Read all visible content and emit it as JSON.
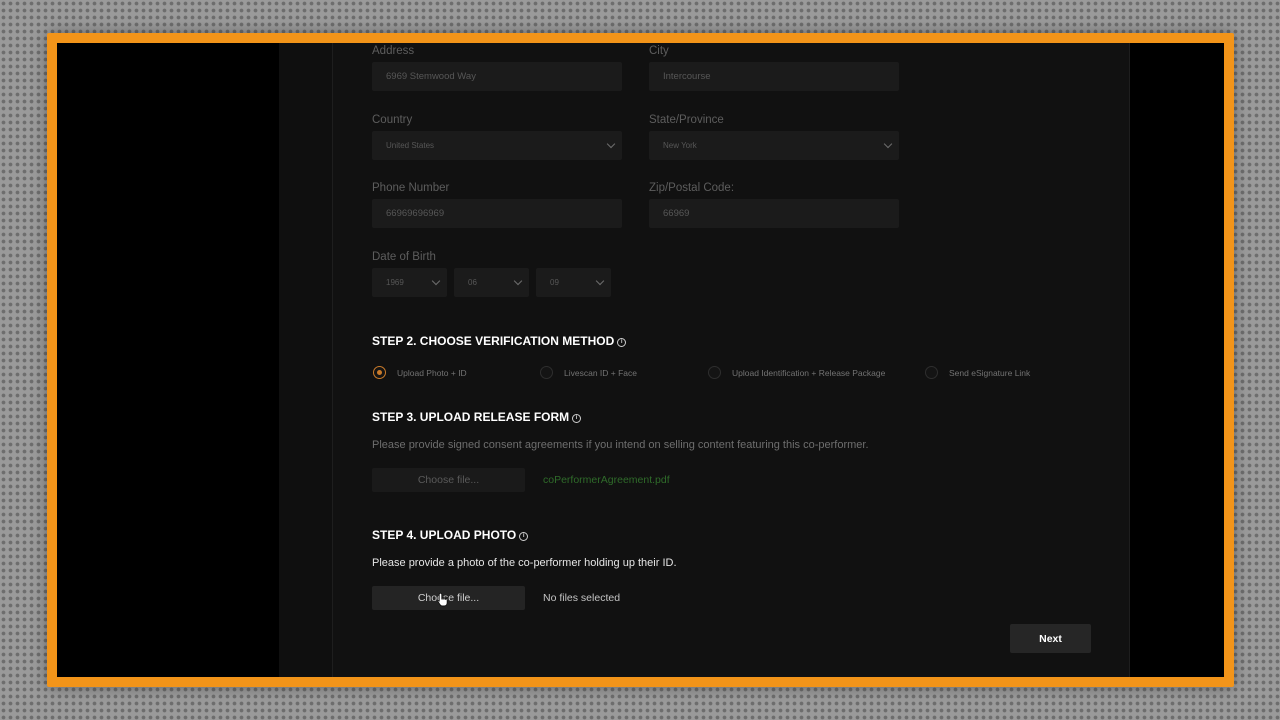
{
  "colors": {
    "frame": "#f29419",
    "accent": "#c97a2a",
    "file_name": "#2f6b2a"
  },
  "form": {
    "address": {
      "label": "Address",
      "value": "6969 Stemwood Way"
    },
    "city": {
      "label": "City",
      "value": "Intercourse"
    },
    "country": {
      "label": "Country",
      "value": "United States"
    },
    "state": {
      "label": "State/Province",
      "value": "New York"
    },
    "phone": {
      "label": "Phone Number",
      "value": "66969696969"
    },
    "zip": {
      "label": "Zip/Postal Code:",
      "value": "66969"
    },
    "dob": {
      "label": "Date of Birth",
      "year": "1969",
      "month": "06",
      "day": "09"
    }
  },
  "step2": {
    "title": "STEP 2. CHOOSE VERIFICATION METHOD",
    "options": [
      {
        "label": "Upload Photo + ID",
        "selected": true
      },
      {
        "label": "Livescan ID + Face",
        "selected": false
      },
      {
        "label": "Upload Identification + Release Package",
        "selected": false
      },
      {
        "label": "Send eSignature Link",
        "selected": false
      }
    ]
  },
  "step3": {
    "title": "STEP 3. UPLOAD RELEASE FORM",
    "description": "Please provide signed consent agreements if you intend on selling content featuring this co-performer.",
    "button": "Choose file...",
    "file_name": "coPerformerAgreement.pdf"
  },
  "step4": {
    "title": "STEP 4. UPLOAD PHOTO",
    "description": "Please provide a photo of the co-performer holding up their ID.",
    "button": "Choose file...",
    "file_status": "No files selected"
  },
  "next_label": "Next",
  "icons": {
    "info": "info-icon",
    "chevron": "chevron-down-icon",
    "cursor": "hand-pointer-icon"
  }
}
